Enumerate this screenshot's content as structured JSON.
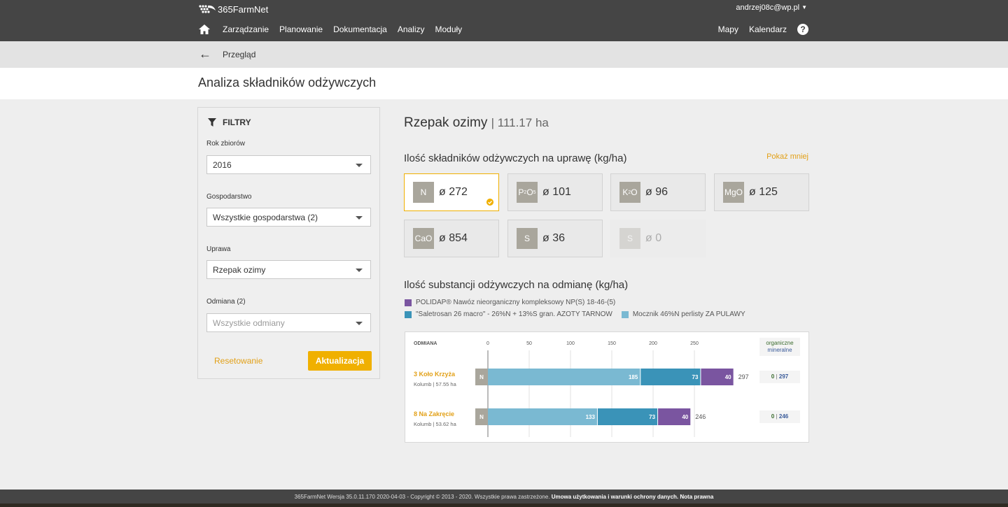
{
  "header": {
    "logo": "365FarmNet",
    "user": "andrzej08c@wp.pl",
    "nav": [
      "Zarządzanie",
      "Planowanie",
      "Dokumentacja",
      "Analizy",
      "Moduły"
    ],
    "nav_right": [
      "Mapy",
      "Kalendarz"
    ],
    "help": "?"
  },
  "breadcrumb": {
    "label": "Przegląd"
  },
  "page": {
    "title": "Analiza składników odżywczych"
  },
  "filters": {
    "title": "FILTRY",
    "year_label": "Rok zbiorów",
    "year_value": "2016",
    "farm_label": "Gospodarstwo",
    "farm_value": "Wszystkie gospodarstwa (2)",
    "crop_label": "Uprawa",
    "crop_value": "Rzepak ozimy",
    "variety_label": "Odmiana (2)",
    "variety_placeholder": "Wszystkie odmiany",
    "reset": "Resetowanie",
    "update": "Aktualizacja"
  },
  "main": {
    "crop": "Rzepak ozimy",
    "area": "| 111.17 ha",
    "section1": "Ilość składników odżywczych na uprawę (kg/ha)",
    "show_less": "Pokaż mniej",
    "nutrients": [
      {
        "code": "N",
        "value": "ø 272",
        "state": "selected"
      },
      {
        "code": "P2O5",
        "value": "ø 101",
        "state": "normal"
      },
      {
        "code": "K2O",
        "value": "ø 96",
        "state": "normal"
      },
      {
        "code": "MgO",
        "value": "ø 125",
        "state": "normal"
      },
      {
        "code": "CaO",
        "value": "ø 854",
        "state": "normal"
      },
      {
        "code": "S",
        "value": "ø 36",
        "state": "normal"
      },
      {
        "code": "S",
        "value": "ø 0",
        "state": "disabled"
      }
    ],
    "section2": "Ilość substancji odżywczych na odmianę (kg/ha)",
    "legend": [
      {
        "name": "POLIDAP® Nawóz nieorganiczny kompleksowy NP(S) 18-46-(5)",
        "color": "#7a55a0"
      },
      {
        "name": "\"Saletrosan 26 macro\" - 26%N + 13%S gran. AZOTY TARNOW",
        "color": "#3a93b8"
      },
      {
        "name": "Mocznik 46%N perlisty ZA PULAWY",
        "color": "#7ab9d2"
      }
    ]
  },
  "chart_data": {
    "type": "bar",
    "orientation": "horizontal",
    "stacked": true,
    "column_header": "ODMIANA",
    "x_ticks": [
      0,
      50,
      100,
      150,
      200,
      250
    ],
    "xlim": [
      0,
      300
    ],
    "categories": [
      {
        "name": "3 Koło Krzyża",
        "sub": "Kolumb | 57.55 ha",
        "nutrient": "N",
        "total": 297,
        "org_min": [
          "0",
          "297"
        ]
      },
      {
        "name": "8 Na Zakręcie",
        "sub": "Kolumb | 53.62 ha",
        "nutrient": "N",
        "total": 246,
        "org_min": [
          "0",
          "246"
        ]
      }
    ],
    "series": [
      {
        "name": "Mocznik 46%N perlisty ZA PULAWY",
        "color": "#7ab9d2",
        "values": [
          185,
          133
        ]
      },
      {
        "name": "\"Saletrosan 26 macro\" - 26%N + 13%S gran. AZOTY TARNOW",
        "color": "#3a93b8",
        "values": [
          73,
          73
        ]
      },
      {
        "name": "POLIDAP® Nawóz nieorganiczny kompleksowy NP(S) 18-46-(5)",
        "color": "#7a55a0",
        "values": [
          40,
          40
        ]
      }
    ],
    "org_header": [
      "organiczne",
      "mineralne"
    ]
  },
  "footer": {
    "text": "365FarmNet Wersja 35.0.11.170 2020-04-03 - Copyright © 2013 - 2020. Wszystkie prawa zastrzeżone.",
    "link1": "Umowa użytkowania i warunki ochrony danych.",
    "link2": "Nota prawna"
  }
}
